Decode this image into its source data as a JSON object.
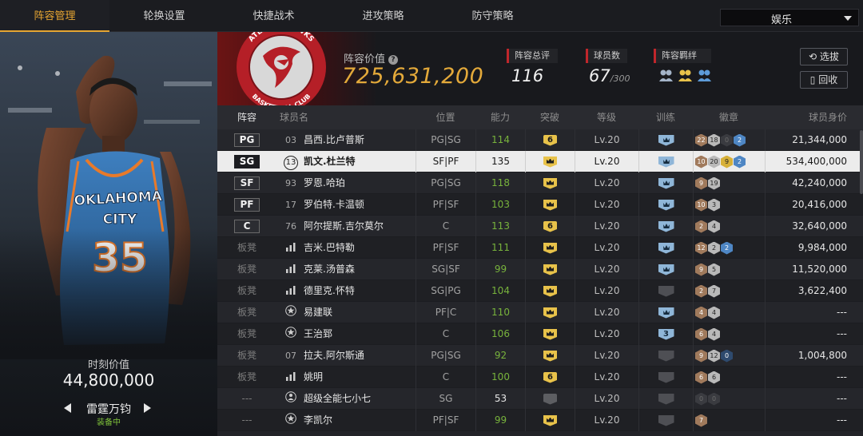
{
  "tabs": [
    "阵容管理",
    "轮换设置",
    "快捷战术",
    "进攻策略",
    "防守策略"
  ],
  "mode_select": "娱乐",
  "player_card": {
    "jersey_team": "OKLAHOMA CITY",
    "jersey_number": "35",
    "moment_label": "时刻价值",
    "moment_value": "44,800,000",
    "card_name": "雷霆万钧",
    "card_status": "装备中"
  },
  "team": {
    "logo_text_top": "ATLANTA HAWKS",
    "logo_text_bottom": "BASKETBALL CLUB",
    "lineup_value_label": "阵容价值",
    "lineup_value": "725,631,200",
    "rating_label": "阵容总评",
    "rating": "116",
    "players_label": "球员数",
    "players_count": "67",
    "players_max": "/300",
    "bond_label": "阵容羁绊",
    "btn_select": "选拔",
    "btn_recycle": "回收"
  },
  "columns": [
    "阵容",
    "球员名",
    "位置",
    "能力",
    "突破",
    "等级",
    "训练",
    "徽章",
    "球员身价"
  ],
  "rows": [
    {
      "slot": "PG",
      "num": "03",
      "name": "昌西.比卢普斯",
      "pos": "PG|SG",
      "ability": "114",
      "brk": "6",
      "lv": "Lv.20",
      "train": "",
      "badges": [
        "b:22",
        "s:18",
        "dk:0",
        "bl:2"
      ],
      "value": "21,344,000"
    },
    {
      "slot": "SG",
      "num": "13",
      "name": "凯文.杜兰特",
      "pos": "SF|PF",
      "ability": "135",
      "brk": "crown",
      "lv": "Lv.20",
      "train": "",
      "badges": [
        "b:10",
        "s:20",
        "g:9",
        "bl:2"
      ],
      "value": "534,400,000"
    },
    {
      "slot": "SF",
      "num": "93",
      "name": "罗恩.哈珀",
      "pos": "PG|SG",
      "ability": "118",
      "brk": "crown",
      "lv": "Lv.20",
      "train": "",
      "badges": [
        "b:9",
        "s:19"
      ],
      "value": "42,240,000"
    },
    {
      "slot": "PF",
      "num": "17",
      "name": "罗伯特.卡温顿",
      "pos": "PF|SF",
      "ability": "103",
      "brk": "crown",
      "lv": "Lv.20",
      "train": "",
      "badges": [
        "b:10",
        "s:3"
      ],
      "value": "20,416,000"
    },
    {
      "slot": "C",
      "num": "76",
      "name": "阿尔提斯.吉尔莫尔",
      "pos": "C",
      "ability": "113",
      "brk": "6",
      "lv": "Lv.20",
      "train": "",
      "badges": [
        "b:2",
        "s:4"
      ],
      "value": "32,640,000"
    },
    {
      "slot": "板凳",
      "num": "",
      "name": "吉米.巴特勒",
      "pos": "PF|SF",
      "ability": "111",
      "brk": "crown",
      "lv": "Lv.20",
      "train": "",
      "badges": [
        "b:12",
        "s:2",
        "bl:2"
      ],
      "value": "9,984,000"
    },
    {
      "slot": "板凳",
      "num": "",
      "name": "克莱.汤普森",
      "pos": "SG|SF",
      "ability": "99",
      "brk": "crown",
      "lv": "Lv.20",
      "train": "",
      "badges": [
        "b:9",
        "s:5"
      ],
      "value": "11,520,000"
    },
    {
      "slot": "板凳",
      "num": "",
      "name": "德里克.怀特",
      "pos": "SG|PG",
      "ability": "104",
      "brk": "crown",
      "lv": "Lv.20",
      "train": "gray",
      "badges": [
        "b:2",
        "s:7"
      ],
      "value": "3,622,400"
    },
    {
      "slot": "板凳",
      "num": "",
      "name": "易建联",
      "pos": "PF|C",
      "ability": "110",
      "brk": "crown",
      "lv": "Lv.20",
      "train": "",
      "badges": [
        "b:4",
        "s:4"
      ],
      "value": "---"
    },
    {
      "slot": "板凳",
      "num": "",
      "name": "王治郅",
      "pos": "C",
      "ability": "106",
      "brk": "crown",
      "lv": "Lv.20",
      "train": "3",
      "badges": [
        "b:6",
        "s:4"
      ],
      "value": "---"
    },
    {
      "slot": "板凳",
      "num": "07",
      "name": "拉夫.阿尔斯通",
      "pos": "PG|SG",
      "ability": "92",
      "brk": "crown",
      "lv": "Lv.20",
      "train": "gray",
      "badges": [
        "b:9",
        "s:12",
        "nav:0"
      ],
      "value": "1,004,800"
    },
    {
      "slot": "板凳",
      "num": "",
      "name": "姚明",
      "pos": "C",
      "ability": "100",
      "brk": "6",
      "lv": "Lv.20",
      "train": "gray",
      "badges": [
        "b:6",
        "s:6"
      ],
      "value": "---"
    },
    {
      "slot": "---",
      "num": "",
      "name": "超级全能七小七",
      "pos": "SG",
      "ability": "53",
      "brk": "gray",
      "lv": "Lv.20",
      "train": "gray",
      "badges": [
        "dk:0",
        "dk:0"
      ],
      "value": "---"
    },
    {
      "slot": "---",
      "num": "",
      "name": "李凯尔",
      "pos": "PF|SF",
      "ability": "99",
      "brk": "crown",
      "lv": "Lv.20",
      "train": "gray",
      "badges": [
        "b:7"
      ],
      "value": "---"
    }
  ],
  "row_icons": [
    "",
    "",
    "",
    "",
    "",
    "bars-icon",
    "bars-icon",
    "bars-icon",
    "star-icon",
    "star-icon",
    "",
    "bars-icon",
    "person-icon",
    "star-icon"
  ],
  "colors": {
    "accent": "#e6a532",
    "ability_green": "#78b33c",
    "brand_red": "#c0262b"
  }
}
